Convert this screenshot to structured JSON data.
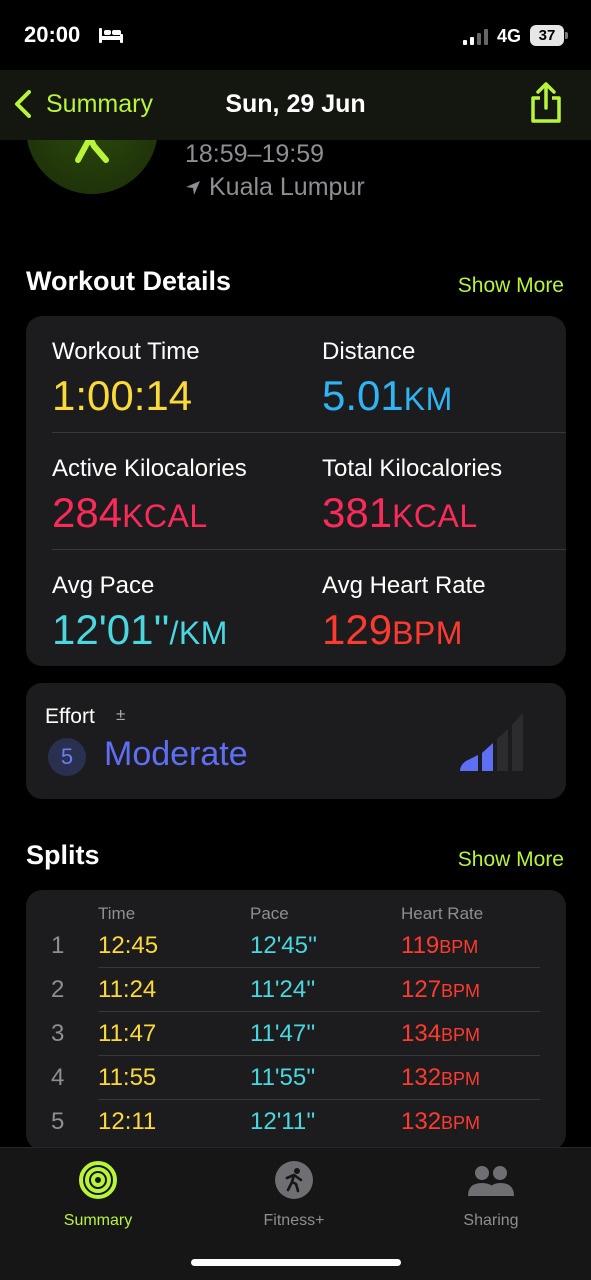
{
  "status_bar": {
    "time": "20:00",
    "network": "4G",
    "battery": "37"
  },
  "nav": {
    "back_label": "Summary",
    "title": "Sun, 29 Jun"
  },
  "workout_header": {
    "time_range": "18:59–19:59",
    "location": "Kuala Lumpur"
  },
  "workout_details": {
    "title": "Workout Details",
    "show_more": "Show More",
    "metrics": {
      "workout_time": {
        "label": "Workout Time",
        "value": "1:00:14"
      },
      "distance": {
        "label": "Distance",
        "value": "5.01",
        "unit": "KM"
      },
      "active_kcal": {
        "label": "Active Kilocalories",
        "value": "284",
        "unit": "KCAL"
      },
      "total_kcal": {
        "label": "Total Kilocalories",
        "value": "381",
        "unit": "KCAL"
      },
      "avg_pace": {
        "label": "Avg Pace",
        "value": "12'01''",
        "unit": "/KM"
      },
      "avg_hr": {
        "label": "Avg Heart Rate",
        "value": "129",
        "unit": "BPM"
      }
    }
  },
  "effort": {
    "label": "Effort",
    "adjust_symbol": "±",
    "score": "5",
    "level": "Moderate"
  },
  "splits": {
    "title": "Splits",
    "show_more": "Show More",
    "headers": {
      "time": "Time",
      "pace": "Pace",
      "heart_rate": "Heart Rate"
    },
    "rows": [
      {
        "index": "1",
        "time": "12:45",
        "pace": "12'45''",
        "hr": "119",
        "hr_unit": "BPM"
      },
      {
        "index": "2",
        "time": "11:24",
        "pace": "11'24''",
        "hr": "127",
        "hr_unit": "BPM"
      },
      {
        "index": "3",
        "time": "11:47",
        "pace": "11'47''",
        "hr": "134",
        "hr_unit": "BPM"
      },
      {
        "index": "4",
        "time": "11:55",
        "pace": "11'55''",
        "hr": "132",
        "hr_unit": "BPM"
      },
      {
        "index": "5",
        "time": "12:11",
        "pace": "12'11''",
        "hr": "132",
        "hr_unit": "BPM"
      }
    ]
  },
  "tabs": [
    {
      "label": "Summary",
      "icon": "activity-rings-icon",
      "active": true
    },
    {
      "label": "Fitness+",
      "icon": "fitness-plus-runner-icon",
      "active": false
    },
    {
      "label": "Sharing",
      "icon": "sharing-people-icon",
      "active": false
    }
  ],
  "colors": {
    "accent": "#b8f53a",
    "time": "#fbd93a",
    "distance": "#2fb4f5",
    "calories": "#fa2a59",
    "pace": "#4ad7e0",
    "heart_rate": "#ff3b2f",
    "effort": "#5f6ff5"
  }
}
